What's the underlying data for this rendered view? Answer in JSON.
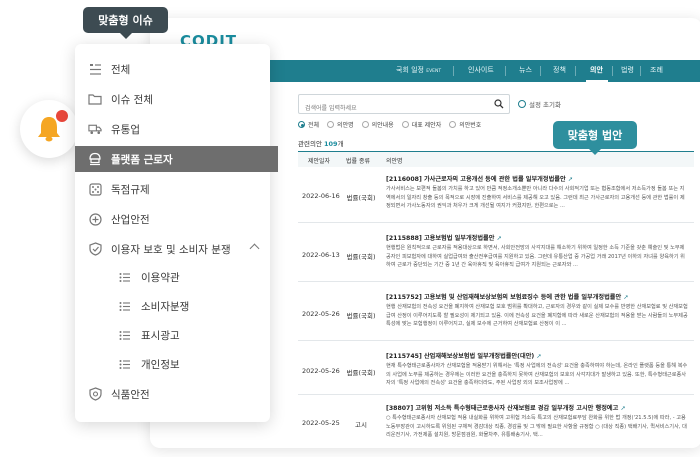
{
  "app": {
    "logo_text": "CODIT",
    "nav": [
      {
        "label": "국회 일정",
        "badge": "EVENT"
      },
      {
        "label": "인사이트"
      },
      {
        "label": "뉴스"
      },
      {
        "label": "정책"
      },
      {
        "label": "의안",
        "active": true
      },
      {
        "label": "법령"
      },
      {
        "label": "조례"
      }
    ],
    "search_placeholder": "검색어를 입력하세요",
    "reset_label": "설정 초기화",
    "radios": [
      "전체",
      "의안명",
      "의안내용",
      "대표 제안자",
      "의안번호"
    ],
    "result_prefix": "관련의안",
    "result_count": "109",
    "result_suffix": "개",
    "columns": [
      "제안일자",
      "법률 종류",
      "의안명"
    ],
    "rows": [
      {
        "date": "2022-06-16",
        "type": "법률(국회)",
        "title": "[2116008] 가사근로자의 고용개선 등에 관한 법률 일부개정법률안",
        "body": "가사서비스는 보편적 돌봄의 가치를 하고 있어 만큼 적정소개소뿐만 아니라 다수의 사회적기업 또는 협동조합에서 저소득가정 돌봄 또는 지역에서의 일자리 창출 등의 목적으로 시장에 진출하여 서비스를 제공해 오고 있음. 그런데 최근 가사근로자의 고용개선 등에 관한 법률이 제정되면서 가사노동자의 권익과 처우가 크게 개선될 여지가 커졌지만, 한편으로는 ..."
      },
      {
        "date": "2022-06-13",
        "type": "법률(국회)",
        "title": "[2115888] 고용보험법 일부개정법률안",
        "body": "현행법은 원칙적으로 근로자를 적용대상으로 하면서, 사회안전망의 사각지대를 해소하기 위하여 일정한 소득 기준을 갖춘 예술인 및 노무제공자인 피보험자에 대하여 실업급여와 출산전후급여를 지원하고 있음. 그런데 유통산업 중 가공업 거래 2017년 이하의 자녀를 양육하기 위하여 근로가 중단되는 기간 중 1년 간 육아휴직 및 육아휴직 급여가 지원되는 근로자와 ..."
      },
      {
        "date": "2022-05-26",
        "type": "법률(국회)",
        "title": "[2115752] 고용보험 및 산업재해보상보험의 보험료징수 등에 관한 법률 일부개정법률안",
        "body": "현행 산재보험의 전속성 요건을 폐지하여 산재보험 보호 범위를 확대하고, 근로자의 경우와 같이 실제 보수를 반영한 산재보험료 및 산재보험급여 산정이 이루어지도록 할 필요성이 제기되고 있음. 이에 전속성 요건을 폐지함에 따라 새로운 산재보험의 적용을 받는 사람들의 노무제공 특성에 맞는 보험행정이 이루어지고, 실제 보수에 근거하여 산재보험료 산정이 이 ..."
      },
      {
        "date": "2022-05-26",
        "type": "법률(국회)",
        "title": "[2115745] 산업재해보상보험법 일부개정법률안(대안)",
        "body": "현재 특수형태근로종사자가 산재보험을 적용받기 위해서는 '특정 사업에의 전속성' 요건을 충족하여야 하는데, 온라인 플랫폼 등을 통해 복수의 사업에 노무를 제공하는 경우에는 이러한 요건을 충족하지 못하여 산재보험의 보호의 사각지대가 발생하고 있음. 또한, 특수형태근로종사자의 '특정 사업에의 전속성' 요건을 충족하더라도, 주된 사업장 외의 보조사업장에 ..."
      },
      {
        "date": "2022-05-25",
        "type": "고시",
        "title": "[38807] 고위험 저소득 특수형태근로종사자 산재보험료 경감 일부개정 고시안 행정예고",
        "body": "○ 특수형태근로종사자 산재보험 적용 내실화를 위하여 고위험 저소득 특고의 산재보험료부담 완화를 위한 법 개정('21.5.5)에 따라, - 고용노동부장관이 고시하도록 위임된 구체적 경감대상 직종, 경감률 및 그 밖에 필요한 사항을 규정함 ○ (대상 직종) 택배기사, 퀵서비스기사, 대리운전기사, 가전제품 설치원, 방문점검원, 화물차주, 유통배송기사, 택..."
      }
    ]
  },
  "bubbles": {
    "menu_title": "맞춤형 이슈",
    "bill_title": "맞춤형 법안"
  },
  "menu": {
    "items": [
      {
        "label": "전체",
        "icon": "list-doc-icon"
      },
      {
        "label": "이슈 전체",
        "icon": "folder-icon"
      },
      {
        "label": "유통업",
        "icon": "truck-icon"
      },
      {
        "label": "플랫폼 근로자",
        "icon": "delivery-person-icon",
        "active": true
      },
      {
        "label": "독점규제",
        "icon": "dice-icon"
      },
      {
        "label": "산업안전",
        "icon": "plus-circle-icon"
      },
      {
        "label": "이용자 보호 및 소비자 분쟁",
        "icon": "shield-check-icon",
        "expanded": true
      },
      {
        "label": "이용약관",
        "icon": "list-icon",
        "sub": true
      },
      {
        "label": "소비자분쟁",
        "icon": "list-icon",
        "sub": true
      },
      {
        "label": "표시광고",
        "icon": "list-icon",
        "sub": true
      },
      {
        "label": "개인정보",
        "icon": "list-icon",
        "sub": true
      },
      {
        "label": "식품안전",
        "icon": "shield-icon"
      }
    ]
  },
  "colors": {
    "accent": "#1f7e8e",
    "bubble_teal": "#2e8f9e",
    "bubble_dark": "#3d4b52",
    "active_menu": "#6e6e6e",
    "bell": "#f5a623",
    "notification_dot": "#e8473b"
  }
}
